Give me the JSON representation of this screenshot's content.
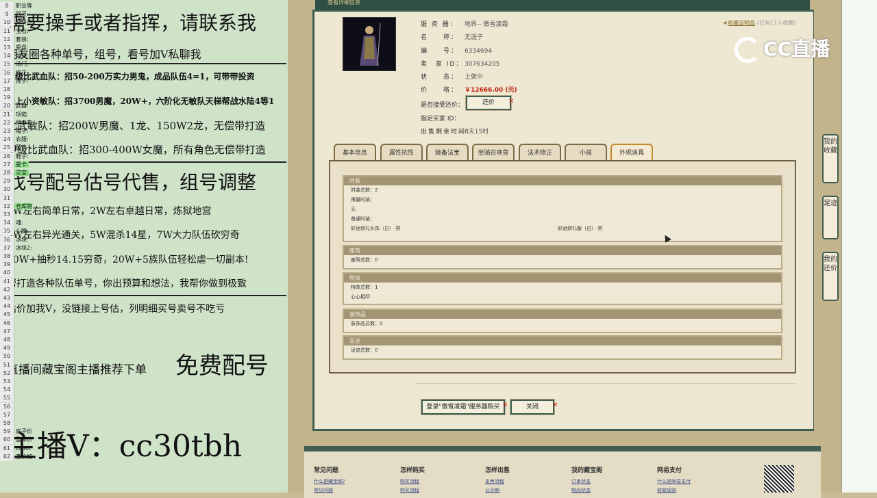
{
  "ad": {
    "lines": [
      "需要操手或者指挥，请联系我",
      "朋友圈各种单号，组号，看号加V私聊我",
      "甲级比武血队：招50-200万实力男鬼，成品队伍4=1，可带带投资",
      "四上小资敏队：招3700男魔，20W+，六阶化无敏队天梯帮战水陆4等1",
      "比武敏队：招200W男魔、1龙、150W2龙，无偿带打造",
      "甲级比武血队：招300-400W女魔，所有角色无偿带打造",
      "找号配号估号代售，组号调整",
      "1W左右简单日常，2W左右卓越日常，炼狱地宫",
      "3W左右异光通关，5W混杀14星，7W大力队伍砍穷奇",
      "10W+抽秒14.15穷奇，20W+5族队伍轻松虐一切副本!",
      "帮打造各种队伍单号，你出预算和想法，我帮你做到极致",
      "估价加我V，没链接上号估，列明细买号卖号不吃亏",
      "直播间藏宝阁主播推荐下单",
      "免费配号",
      "主播V：cc30tbh"
    ]
  },
  "window": {
    "title": "查看详细信息"
  },
  "listing": {
    "server_label": "服 务 器：",
    "server_value": "地界-- 傲雪凌霜",
    "name_label": "名　　称：",
    "name_value": "无涯子",
    "id_label": "编　　号：",
    "id_value": "6334694",
    "seller_label": "卖　家 ID：",
    "seller_value": "307634205",
    "status_label": "状　　态：",
    "status_value": "上架中",
    "price_label": "价　　格：",
    "price_value": "￥12666.00 (元)",
    "bargain_label": "是否接受还价：",
    "bargain_button": "还价",
    "buyer_label": "指定买家 ID：",
    "remain_label": "出售剩余时间：",
    "remain_value": "6天15时",
    "favorite": "收藏该物品",
    "favorite_count": "(已有17人收藏)"
  },
  "tabs": [
    "基本信息",
    "属性抗性",
    "装备法宝",
    "坐骑召唤兽",
    "法术修正",
    "小孩",
    "外观道具"
  ],
  "active_tab": "外观道具",
  "sections": {
    "fashion": {
      "title": "时装",
      "total": "时装总数：2",
      "limited_label": "限量时装：",
      "limited_value": "无",
      "normal_label": "普通时装：",
      "item1": "好运烧礼头饰（白）-男",
      "item2": "好运烧礼服（白）-男"
    },
    "mount": {
      "title": "座驾",
      "total": "座驾总数：0"
    },
    "effect": {
      "title": "特效",
      "total": "特效总数：1",
      "item": "心心相印"
    },
    "decor": {
      "title": "装饰品",
      "total": "装饰品总数：0"
    },
    "footprint": {
      "title": "足迹",
      "total": "足迹总数：0"
    }
  },
  "actions": {
    "login_buy": "登录\"傲雪凌霜\"服务器购买",
    "close": "关闭"
  },
  "side_tabs": [
    "我的收藏",
    "足迹",
    "我的还价"
  ],
  "footer": {
    "cols": [
      "常见问题",
      "怎样购买",
      "怎样出售",
      "我的藏宝阁",
      "网易支付"
    ],
    "links": [
      "什么是藏宝阁?",
      "购买流程",
      "出售流程",
      "订单状态",
      "什么是网易支付",
      "常见问题",
      "购买流程",
      "公示期",
      "物品状态",
      "收款规则"
    ]
  },
  "watermark": "CC直播",
  "sheet": {
    "rows": [
      {
        "n": "8",
        "t": "职业等"
      },
      {
        "n": "9",
        "t": "回灵:"
      },
      {
        "n": "10",
        "t": "月饼点"
      },
      {
        "n": "11",
        "t": "宝石:"
      },
      {
        "n": "12",
        "t": "套装:"
      },
      {
        "n": "13",
        "t": "星盘:"
      },
      {
        "n": "14",
        "t": "坐骑:"
      },
      {
        "n": "15",
        "t": "法门:"
      },
      {
        "n": "16",
        "t": "修正:"
      },
      {
        "n": "17",
        "t": "孩子:"
      },
      {
        "n": "18",
        "t": ""
      },
      {
        "n": "19",
        "t": ""
      },
      {
        "n": "20",
        "t": "武器:"
      },
      {
        "n": "21",
        "t": "项链:"
      },
      {
        "n": "22",
        "t": "护身符"
      },
      {
        "n": "23",
        "t": "帽子:"
      },
      {
        "n": "24",
        "t": "衣服:"
      },
      {
        "n": "25",
        "t": "配饰+"
      },
      {
        "n": "26",
        "t": "鞋子:"
      },
      {
        "n": "27",
        "t": "星卡:"
      },
      {
        "n": "28",
        "t": "灵宝:"
      },
      {
        "n": "29",
        "t": ""
      },
      {
        "n": "30",
        "t": ""
      },
      {
        "n": "31",
        "t": ""
      },
      {
        "n": "32",
        "t": "仓库物"
      },
      {
        "n": "33",
        "t": ""
      },
      {
        "n": "34",
        "t": "魂:"
      },
      {
        "n": "35",
        "t": "心猿:"
      },
      {
        "n": "36",
        "t": "冰块:"
      },
      {
        "n": "37",
        "t": "冰块2:"
      },
      {
        "n": "38",
        "t": ""
      },
      {
        "n": "39",
        "t": ""
      },
      {
        "n": "40",
        "t": ""
      },
      {
        "n": "41",
        "t": ""
      },
      {
        "n": "42",
        "t": ""
      },
      {
        "n": "43",
        "t": ""
      },
      {
        "n": "44",
        "t": ""
      },
      {
        "n": "45",
        "t": ""
      },
      {
        "n": "46",
        "t": ""
      },
      {
        "n": "47",
        "t": ""
      },
      {
        "n": "48",
        "t": ""
      },
      {
        "n": "49",
        "t": ""
      },
      {
        "n": "50",
        "t": ""
      },
      {
        "n": "51",
        "t": ""
      },
      {
        "n": "52",
        "t": ""
      },
      {
        "n": "53",
        "t": ""
      },
      {
        "n": "54",
        "t": ""
      },
      {
        "n": "55",
        "t": ""
      },
      {
        "n": "56",
        "t": ""
      },
      {
        "n": "57",
        "t": ""
      },
      {
        "n": "58",
        "t": ""
      },
      {
        "n": "59",
        "t": "底子价"
      },
      {
        "n": "60",
        "t": "整体价"
      },
      {
        "n": "61",
        "t": "cc30t"
      },
      {
        "n": "62",
        "t": "查价加"
      }
    ]
  }
}
